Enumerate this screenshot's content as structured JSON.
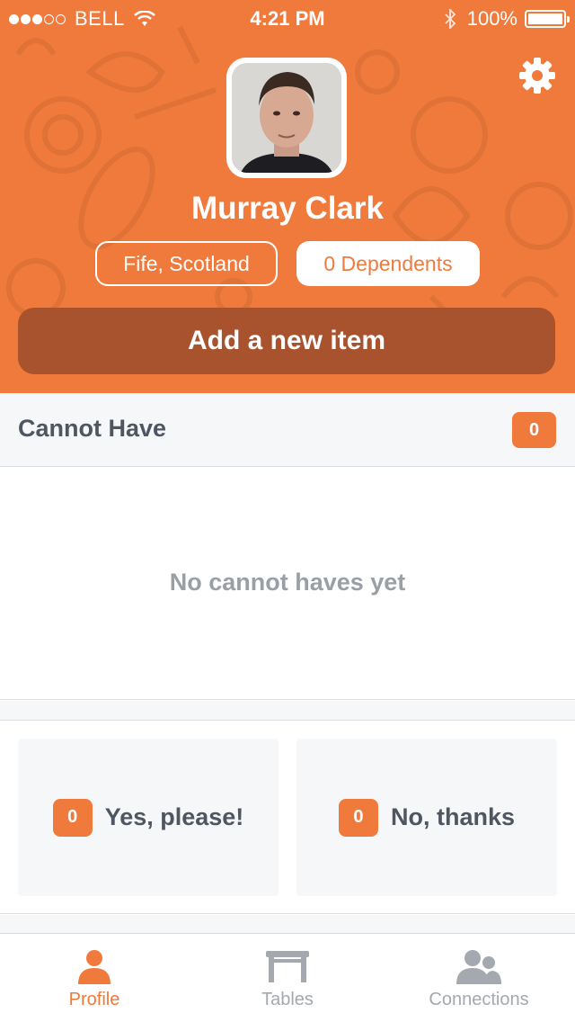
{
  "status_bar": {
    "carrier": "BELL",
    "time": "4:21 PM",
    "battery": "100%",
    "signal_bars_filled": 3,
    "signal_bars_total": 5
  },
  "profile": {
    "name": "Murray Clark",
    "location": "Fife, Scotland",
    "dependents": "0 Dependents",
    "add_button": "Add a new item"
  },
  "cannot_have": {
    "title": "Cannot Have",
    "count": "0",
    "empty_text": "No cannot haves yet"
  },
  "preferences": {
    "yes": {
      "count": "0",
      "label": "Yes, please!"
    },
    "no": {
      "count": "0",
      "label": "No, thanks"
    }
  },
  "tabs": [
    {
      "label": "Profile",
      "icon": "person-icon",
      "active": true
    },
    {
      "label": "Tables",
      "icon": "table-icon",
      "active": false
    },
    {
      "label": "Connections",
      "icon": "people-icon",
      "active": false
    }
  ],
  "colors": {
    "accent": "#F07A3C",
    "button_dark": "#A8522E",
    "text_dark": "#4E5661",
    "text_muted": "#9A9FA6",
    "tab_inactive": "#A4A9B0"
  }
}
